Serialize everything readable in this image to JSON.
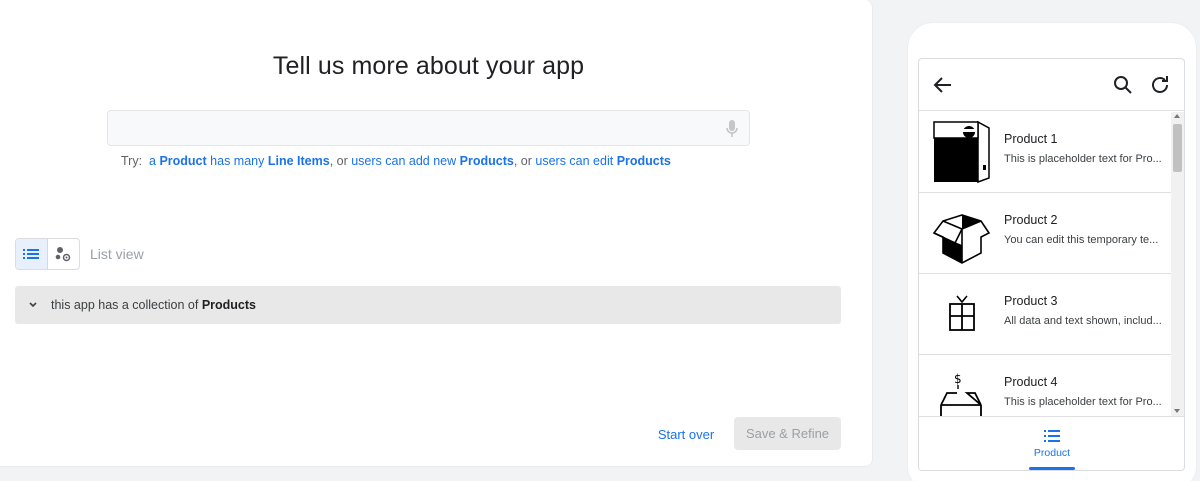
{
  "main": {
    "title": "Tell us more about your app",
    "prompt_value": "",
    "prompt_placeholder": "",
    "try": {
      "prefix": "Try:",
      "s1_a": "a",
      "s1_b": "Product",
      "s1_c": "has many",
      "s1_d": "Line Items",
      "sep1": ", or",
      "s2_a": "users can add new",
      "s2_b": "Products",
      "sep2": ", or",
      "s3_a": "users can edit",
      "s3_b": "Products"
    },
    "view_label": "List view",
    "collection": {
      "prefix": "this app has a collection of",
      "entity": "Products"
    },
    "start_over": "Start over",
    "save_refine": "Save & Refine"
  },
  "preview": {
    "items": [
      {
        "title": "Product 1",
        "desc": "This is placeholder text for Pro..."
      },
      {
        "title": "Product 2",
        "desc": "You can edit this temporary te..."
      },
      {
        "title": "Product 3",
        "desc": "All data and text shown, includ..."
      },
      {
        "title": "Product 4",
        "desc": "This is placeholder text for Pro..."
      }
    ],
    "nav_tab": "Product"
  },
  "colors": {
    "accent": "#1a73e8",
    "bar_bg": "#e8e8e8",
    "muted_text": "#9aa0a6"
  }
}
